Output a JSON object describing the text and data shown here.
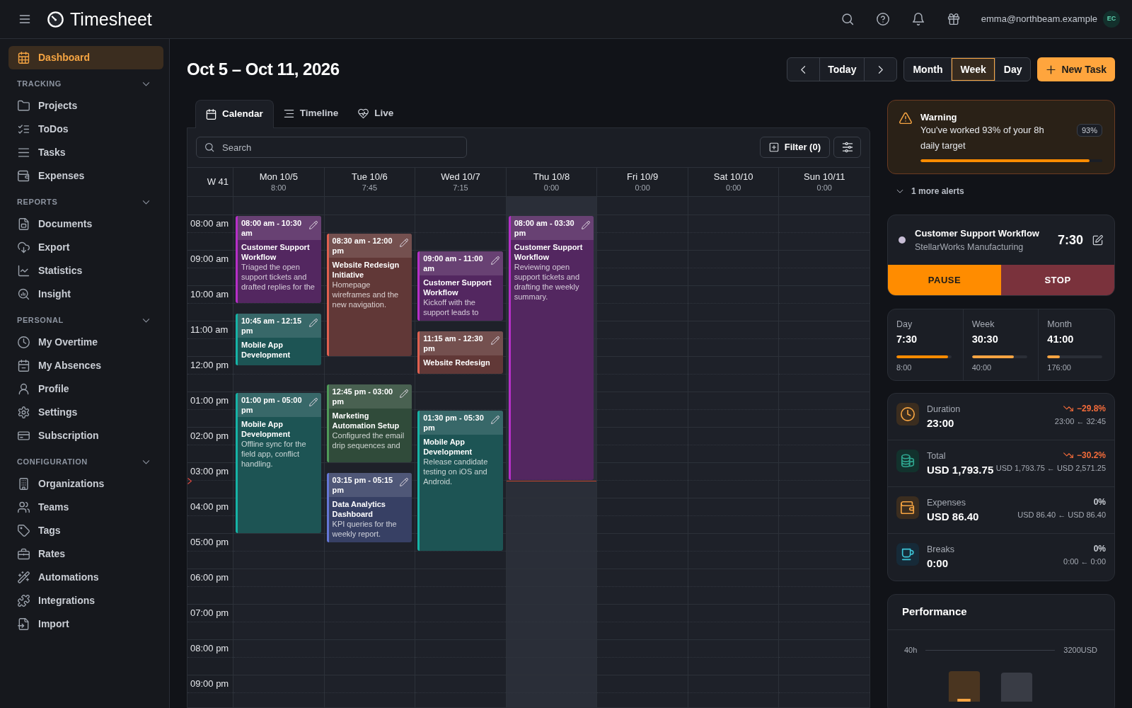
{
  "app": {
    "title": "Timesheet"
  },
  "user": {
    "email": "emma@northbeam.example",
    "initials": "EC"
  },
  "sidebar": {
    "items": [
      {
        "label": "Dashboard",
        "selected": true
      }
    ],
    "sections": [
      {
        "title": "TRACKING",
        "expanded": true,
        "items": [
          {
            "label": "Projects",
            "selected": false
          },
          {
            "label": "ToDos",
            "selected": false
          },
          {
            "label": "Tasks",
            "selected": false
          },
          {
            "label": "Expenses",
            "selected": false
          }
        ]
      },
      {
        "title": "REPORTS",
        "expanded": true,
        "items": [
          {
            "label": "Documents",
            "selected": false
          },
          {
            "label": "Export",
            "selected": false
          },
          {
            "label": "Statistics",
            "selected": false
          },
          {
            "label": "Insight",
            "selected": false
          }
        ]
      },
      {
        "title": "PERSONAL",
        "expanded": true,
        "items": [
          {
            "label": "My Overtime",
            "selected": false
          },
          {
            "label": "My Absences",
            "selected": false
          },
          {
            "label": "Profile",
            "selected": false
          },
          {
            "label": "Settings",
            "selected": false
          },
          {
            "label": "Subscription",
            "selected": false
          }
        ]
      },
      {
        "title": "CONFIGURATION",
        "expanded": true,
        "items": [
          {
            "label": "Organizations",
            "selected": false
          },
          {
            "label": "Teams",
            "selected": false
          },
          {
            "label": "Tags",
            "selected": false
          },
          {
            "label": "Rates",
            "selected": false
          },
          {
            "label": "Automations",
            "selected": false
          },
          {
            "label": "Integrations",
            "selected": false
          },
          {
            "label": "Import",
            "selected": false
          }
        ]
      }
    ]
  },
  "toolbar": {
    "date_range": "Oct 5 – Oct 11, 2026",
    "today": "Today",
    "views": [
      {
        "label": "Month",
        "selected": false
      },
      {
        "label": "Week",
        "selected": true
      },
      {
        "label": "Day",
        "selected": false
      }
    ],
    "new_task": "New Task"
  },
  "tabs": [
    {
      "label": "Calendar",
      "selected": true
    },
    {
      "label": "Timeline",
      "selected": false
    },
    {
      "label": "Live",
      "selected": false
    }
  ],
  "calendar": {
    "search": {
      "placeholder": "Search"
    },
    "filter": "Filter (0)",
    "week": "W 41",
    "now_marker": true,
    "hours": [
      "08:00 am",
      "09:00 am",
      "10:00 am",
      "11:00 am",
      "12:00 pm",
      "01:00 pm",
      "02:00 pm",
      "03:00 pm",
      "04:00 pm",
      "05:00 pm",
      "06:00 pm",
      "07:00 pm",
      "08:00 pm",
      "09:00 pm"
    ],
    "days": [
      {
        "label": "Mon 10/5",
        "total": "8:00",
        "today": false,
        "events": [
          {
            "time": "08:00 am - 10:30 am",
            "title": "Customer Support Workflow",
            "description": "Triaged the open support tickets and drafted replies for the",
            "color": "#b62fc8"
          },
          {
            "time": "10:45 am - 12:15 pm",
            "title": "Mobile App Development",
            "color": "#16b3a6"
          },
          {
            "time": "01:00 pm - 05:00 pm",
            "title": "Mobile App Development",
            "description": "Offline sync for the field app, conflict handling.",
            "color": "#16b3a6"
          }
        ]
      },
      {
        "label": "Tue 10/6",
        "total": "7:45",
        "today": false,
        "events": [
          {
            "time": "08:30 am - 12:00 pm",
            "title": "Website Redesign Initiative",
            "description": "Homepage wireframes and the new navigation.",
            "color": "#e0604f"
          },
          {
            "time": "12:45 pm - 03:00 pm",
            "title": "Marketing Automation Setup",
            "description": "Configured the email drip sequences and",
            "color": "#4f9a58"
          },
          {
            "time": "03:15 pm - 05:15 pm",
            "title": "Data Analytics Dashboard",
            "description": "KPI queries for the weekly report.",
            "color": "#6477d6"
          }
        ]
      },
      {
        "label": "Wed 10/7",
        "total": "7:15",
        "today": false,
        "events": [
          {
            "time": "09:00 am - 11:00 am",
            "title": "Customer Support Workflow",
            "description": "Kickoff with the support leads to",
            "color": "#b62fc8"
          },
          {
            "time": "11:15 am - 12:30 pm",
            "title": "Website Redesign",
            "color": "#e0604f"
          },
          {
            "time": "01:30 pm - 05:30 pm",
            "title": "Mobile App Development",
            "description": "Release candidate testing on iOS and Android.",
            "color": "#16b3a6"
          }
        ]
      },
      {
        "label": "Thu 10/8",
        "total": "0:00",
        "today": true,
        "events": [
          {
            "time": "08:00 am - 03:30 pm",
            "title": "Customer Support Workflow",
            "description": "Reviewing open support tickets and drafting the weekly summary.",
            "color": "#b62fc8"
          }
        ]
      },
      {
        "label": "Fri 10/9",
        "total": "0:00",
        "today": false
      },
      {
        "label": "Sat 10/10",
        "total": "0:00",
        "today": false
      },
      {
        "label": "Sun 10/11",
        "total": "0:00",
        "today": false
      }
    ]
  },
  "alert": {
    "title": "Warning",
    "message": "You've worked 93% of your 8h daily target",
    "badge": "93%",
    "level": 0.93
  },
  "more_alerts": "1 more alerts",
  "timer": {
    "task": "Customer Support Workflow",
    "client": "StellarWorks Manufacturing",
    "elapsed": "7:30",
    "pause": "PAUSE",
    "stop": "STOP"
  },
  "totals": [
    {
      "label": "Day",
      "value": "7:30",
      "target": "8:00",
      "level": 0.94,
      "color": "#ff8c00"
    },
    {
      "label": "Week",
      "value": "30:30",
      "target": "40:00",
      "level": 0.76,
      "color": "#f5a442"
    },
    {
      "label": "Month",
      "value": "41:00",
      "target": "176:00",
      "level": 0.23,
      "color": "#f5a442"
    }
  ],
  "metrics": [
    {
      "label": "Duration",
      "value": "23:00",
      "change": "−29.8%",
      "kind": "decrease",
      "comparison": "23:00 ← 32:45"
    },
    {
      "label": "Total",
      "value": "USD 1,793.75",
      "change": "−30.2%",
      "kind": "decrease",
      "comparison": "USD 1,793.75 ← USD 2,571.25"
    },
    {
      "label": "Expenses",
      "value": "USD 86.40",
      "change": "0%",
      "kind": "unchanged",
      "comparison": "USD 86.40 ← USD 86.40"
    },
    {
      "label": "Breaks",
      "value": "0:00",
      "change": "0%",
      "kind": "unchanged",
      "comparison": "0:00 ← 0:00"
    }
  ],
  "performance": {
    "title": "Performance",
    "left_axis": "40h",
    "right_axis": "3200USD"
  }
}
